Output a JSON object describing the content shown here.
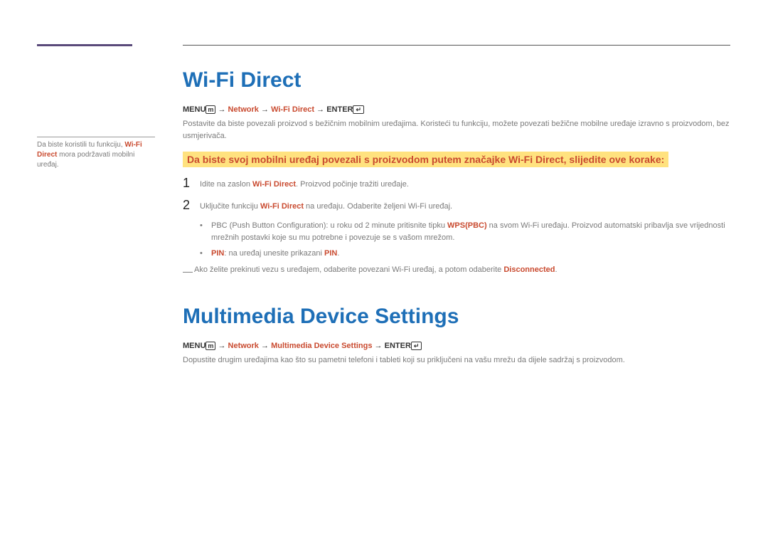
{
  "sidebar": {
    "note_pre": "Da biste koristili tu funkciju, ",
    "note_bold": "Wi-Fi Direct",
    "note_post": " mora podržavati mobilni uređaj."
  },
  "section1": {
    "title": "Wi-Fi Direct",
    "menu": {
      "menu_label": "MENU",
      "arrow": " → ",
      "network": "Network",
      "wifi_direct": "Wi-Fi Direct",
      "enter": "ENTER"
    },
    "intro": "Postavite da biste povezali proizvod s bežičnim mobilnim uređajima. Koristeći tu funkciju, možete povezati bežične mobilne uređaje izravno s proizvodom, bez usmjerivača.",
    "highlight": "Da biste svoj mobilni uređaj povezali s proizvodom putem značajke Wi-Fi Direct, slijedite ove korake:",
    "step1_num": "1",
    "step1_pre": "Idite na zaslon ",
    "step1_bold": "Wi-Fi Direct",
    "step1_post": ". Proizvod počinje tražiti uređaje.",
    "step2_num": "2",
    "step2_pre": "Uključite funkciju ",
    "step2_bold": "Wi-Fi Direct",
    "step2_post": " na uređaju. Odaberite željeni Wi-Fi uređaj.",
    "bullet1_pre": "PBC (Push Button Configuration): u roku od 2 minute pritisnite tipku ",
    "bullet1_bold": "WPS(PBC)",
    "bullet1_post": " na svom Wi-Fi uređaju. Proizvod automatski pribavlja sve vrijednosti mrežnih postavki koje su mu potrebne i povezuje se s vašom mrežom.",
    "bullet2_bold1": "PIN",
    "bullet2_mid": ": na uređaj unesite prikazani ",
    "bullet2_bold2": "PIN",
    "bullet2_end": ".",
    "note_dash": "―",
    "note_pre": "Ako želite prekinuti vezu s uređajem, odaberite povezani Wi-Fi uređaj, a potom odaberite ",
    "note_bold": "Disconnected",
    "note_end": "."
  },
  "section2": {
    "title": "Multimedia Device Settings",
    "menu": {
      "menu_label": "MENU",
      "arrow": " → ",
      "network": "Network",
      "mds": "Multimedia Device Settings",
      "enter": "ENTER"
    },
    "body": "Dopustite drugim uređajima kao što su pametni telefoni i tableti koji su priključeni na vašu mrežu da dijele sadržaj s proizvodom."
  }
}
